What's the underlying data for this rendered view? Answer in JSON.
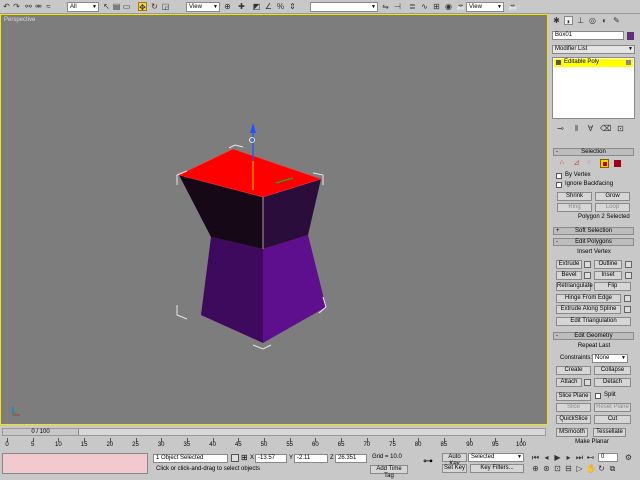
{
  "toolbar": {
    "selection_filter": "All",
    "ref_coord_system": "View",
    "ref_coord_system_2": "View",
    "named_selection": ""
  },
  "viewport": {
    "label": "Perspective"
  },
  "command_panel": {
    "object_name": "Box01",
    "object_color": "#7a1fa0",
    "modifier_list": "Modifier List",
    "stack_item": "Editable Poly",
    "selection": {
      "title": "Selection",
      "by_vertex": "By Vertex",
      "ignore_backfacing": "Ignore Backfacing",
      "shrink": "Shrink",
      "grow": "Grow",
      "ring": "Ring",
      "loop": "Loop",
      "status": "Polygon 2 Selected"
    },
    "soft_selection": {
      "title": "Soft Selection"
    },
    "edit_polygons": {
      "title": "Edit Polygons",
      "insert_vertex": "Insert Vertex",
      "extrude": "Extrude",
      "outline": "Outline",
      "bevel": "Bevel",
      "inset": "Inset",
      "retriangulate": "Retriangulate",
      "flip": "Flip",
      "hinge": "Hinge From Edge",
      "extrude_spline": "Extrude Along Spline",
      "edit_tri": "Edit Triangulation"
    },
    "edit_geometry": {
      "title": "Edit Geometry",
      "repeat_last": "Repeat Last",
      "constraints_label": "Constraints:",
      "constraints_value": "None",
      "create": "Create",
      "collapse": "Collapse",
      "attach": "Attach",
      "detach": "Detach",
      "slice_plane": "Slice Plane",
      "split": "Split",
      "slice": "Slice",
      "reset_plane": "Reset Plane",
      "quickslice": "QuickSlice",
      "cut": "Cut",
      "msmooth": "MSmooth",
      "tessellate": "Tessellate",
      "make_planar": "Make Planar"
    }
  },
  "timeline": {
    "frame_display": "0 / 100",
    "ticks": [
      "0",
      "5",
      "10",
      "15",
      "20",
      "25",
      "30",
      "35",
      "40",
      "45",
      "50",
      "55",
      "60",
      "65",
      "70",
      "75",
      "80",
      "85",
      "90",
      "95",
      "100"
    ]
  },
  "status": {
    "selected": "1 Object Selected",
    "prompt": "Click or click-and-drag to select objects",
    "x_label": "X",
    "x_value": "-13.57",
    "y_label": "Y",
    "y_value": "-2.11",
    "z_label": "Z",
    "z_value": "26.351",
    "grid": "Grid = 10.0",
    "add_time_tag": "Add Time Tag",
    "auto_key": "Auto Key",
    "key_mode": "Selected",
    "set_key": "Set Key",
    "key_filters": "Key Filters...",
    "frame": "0"
  },
  "colors": {
    "viewport_border": "#f2e500",
    "selected_face": "#ff0000",
    "object": "#5a0f87"
  }
}
